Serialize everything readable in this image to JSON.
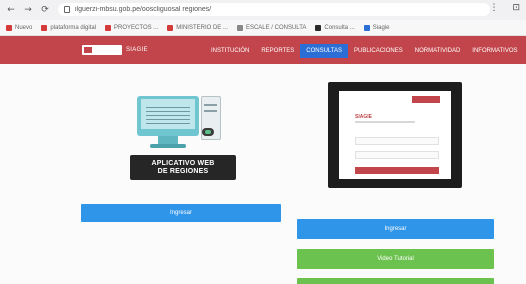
{
  "browser": {
    "url": "ilguerzi-mbsu.gob.pe/ooscliguosal regiones/",
    "nav": {
      "back": "←",
      "forward": "→",
      "reload": "⟳",
      "home": "⌂"
    },
    "right_icons": [
      "⋮",
      "⊡"
    ],
    "bookmarks": [
      {
        "label": "Nuevo",
        "color": "#d33b3b"
      },
      {
        "label": "plataforma digital",
        "color": "#d33b3b"
      },
      {
        "label": "PROYECTOS ...",
        "color": "#d33b3b"
      },
      {
        "label": "MINISTERIO DE ...",
        "color": "#d33b3b"
      },
      {
        "label": "ESCALE / CONSULTA",
        "color": "#888888"
      },
      {
        "label": "Consulta ...",
        "color": "#2a2a2a"
      },
      {
        "label": "Siagie",
        "color": "#2b6fd6"
      }
    ]
  },
  "site": {
    "brand": "MINEDU",
    "brand_text": "SIAGIE",
    "menu": [
      {
        "label": "INSTITUCIÓN",
        "active": false
      },
      {
        "label": "REPORTES",
        "active": false
      },
      {
        "label": "CONSULTAS",
        "active": true
      },
      {
        "label": "PUBLICACIONES",
        "active": false
      },
      {
        "label": "NORMATIVIDAD",
        "active": false
      },
      {
        "label": "INFORMATIVOS",
        "active": false
      }
    ]
  },
  "left": {
    "badge_line1": "APLICATIVO WEB",
    "badge_line2": "DE REGIONES",
    "button": "Ingresar"
  },
  "right": {
    "login_title": "SIAGIE",
    "button_blue": "Ingresar",
    "button_green": "Video Tutorial"
  },
  "colors": {
    "navbar": "#c1454a",
    "active_tab": "#2b6fd6",
    "blue_button": "#2f95e8",
    "green_button": "#6cc24f"
  }
}
